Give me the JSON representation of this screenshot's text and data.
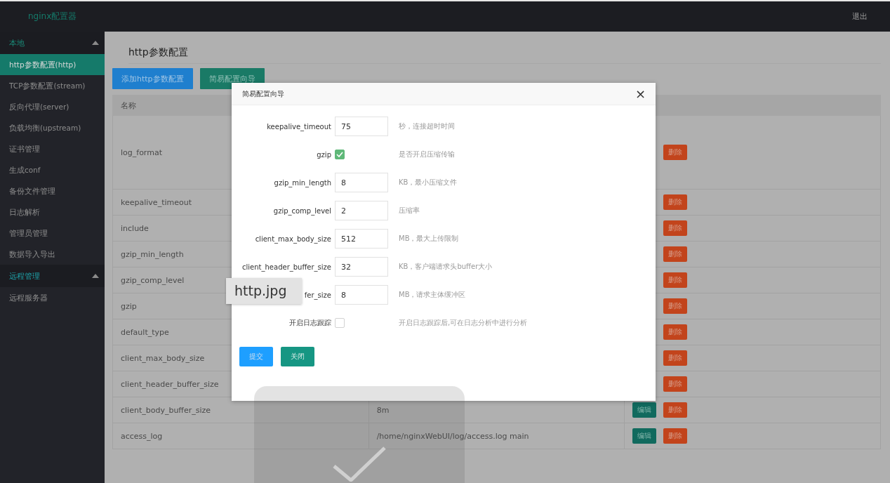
{
  "header": {
    "title": "nginx配置器",
    "logout": "退出"
  },
  "sidebar": [
    {
      "label": "本地",
      "expanded": true,
      "items": [
        {
          "label": "http参数配置(http)",
          "selected": true
        },
        {
          "label": "TCP参数配置(stream)",
          "selected": false
        },
        {
          "label": "反向代理(server)",
          "selected": false
        },
        {
          "label": "负载均衡(upstream)",
          "selected": false
        },
        {
          "label": "证书管理",
          "selected": false
        },
        {
          "label": "生成conf",
          "selected": false
        },
        {
          "label": "备份文件管理",
          "selected": false
        },
        {
          "label": "日志解析",
          "selected": false
        },
        {
          "label": "管理员管理",
          "selected": false
        },
        {
          "label": "数据导入导出",
          "selected": false
        }
      ]
    },
    {
      "label": "远程管理",
      "expanded": true,
      "items": [
        {
          "label": "远程服务器",
          "selected": false
        }
      ]
    }
  ],
  "page": {
    "title": "http参数配置",
    "buttons": [
      {
        "label": "添加http参数配置",
        "kind": "primary"
      },
      {
        "label": "简易配置向导",
        "kind": "secondary"
      }
    ]
  },
  "table": {
    "columns": [
      "名称"
    ],
    "rows": [
      {
        "name": "log_format",
        "actions": [
          {
            "label": "删除",
            "kind": "delete"
          }
        ]
      },
      {
        "name": "keepalive_timeout",
        "actions": [
          {
            "label": "删除",
            "kind": "delete"
          }
        ]
      },
      {
        "name": "include",
        "actions": [
          {
            "label": "删除",
            "kind": "delete"
          }
        ]
      },
      {
        "name": "gzip_min_length",
        "actions": [
          {
            "label": "删除",
            "kind": "delete"
          }
        ]
      },
      {
        "name": "gzip_comp_level",
        "actions": [
          {
            "label": "删除",
            "kind": "delete"
          }
        ]
      },
      {
        "name": "gzip",
        "actions": [
          {
            "label": "删除",
            "kind": "delete"
          }
        ]
      },
      {
        "name": "default_type",
        "actions": [
          {
            "label": "删除",
            "kind": "delete"
          }
        ]
      },
      {
        "name": "client_max_body_size",
        "actions": [
          {
            "label": "删除",
            "kind": "delete"
          }
        ]
      },
      {
        "name": "client_header_buffer_size",
        "actions": [
          {
            "label": "删除",
            "kind": "delete"
          }
        ]
      },
      {
        "name": "client_body_buffer_size",
        "value": "8m",
        "actions": [
          {
            "label": "编辑",
            "kind": "edit"
          },
          {
            "label": "删除",
            "kind": "delete"
          }
        ]
      },
      {
        "name": "access_log",
        "value": "/home/nginxWebUI/log/access.log main",
        "actions": [
          {
            "label": "编辑",
            "kind": "edit"
          },
          {
            "label": "删除",
            "kind": "delete"
          }
        ]
      }
    ]
  },
  "dialog": {
    "title": "简易配置向导",
    "close": "×",
    "fields": [
      {
        "label": "keepalive_timeout",
        "kind": "input",
        "value": "75",
        "hint": "秒，连接超时时间"
      },
      {
        "label": "gzip",
        "kind": "checkbox",
        "checked": true,
        "hint": "是否开启压缩传输"
      },
      {
        "label": "gzip_min_length",
        "kind": "input",
        "value": "8",
        "hint": "KB，最小压缩文件"
      },
      {
        "label": "gzip_comp_level",
        "kind": "input",
        "value": "2",
        "hint": "压缩率"
      },
      {
        "label": "client_max_body_size",
        "kind": "input",
        "value": "512",
        "hint": "MB，最大上传限制"
      },
      {
        "label": "client_header_buffer_size",
        "kind": "input",
        "value": "32",
        "hint": "KB，客户端请求头buffer大小"
      },
      {
        "label": "fer_size",
        "kind": "input",
        "value": "8",
        "hint": "MB，请求主体缓冲区"
      },
      {
        "label": "开启日志跟踪",
        "kind": "checkbox",
        "checked": false,
        "hint": "开启日志跟踪后,可在日志分析中进行分析"
      }
    ],
    "buttons": [
      {
        "label": "提交",
        "kind": "primary"
      },
      {
        "label": "关闭",
        "kind": "secondary"
      }
    ]
  },
  "tooltip": {
    "text": "http.jpg"
  }
}
